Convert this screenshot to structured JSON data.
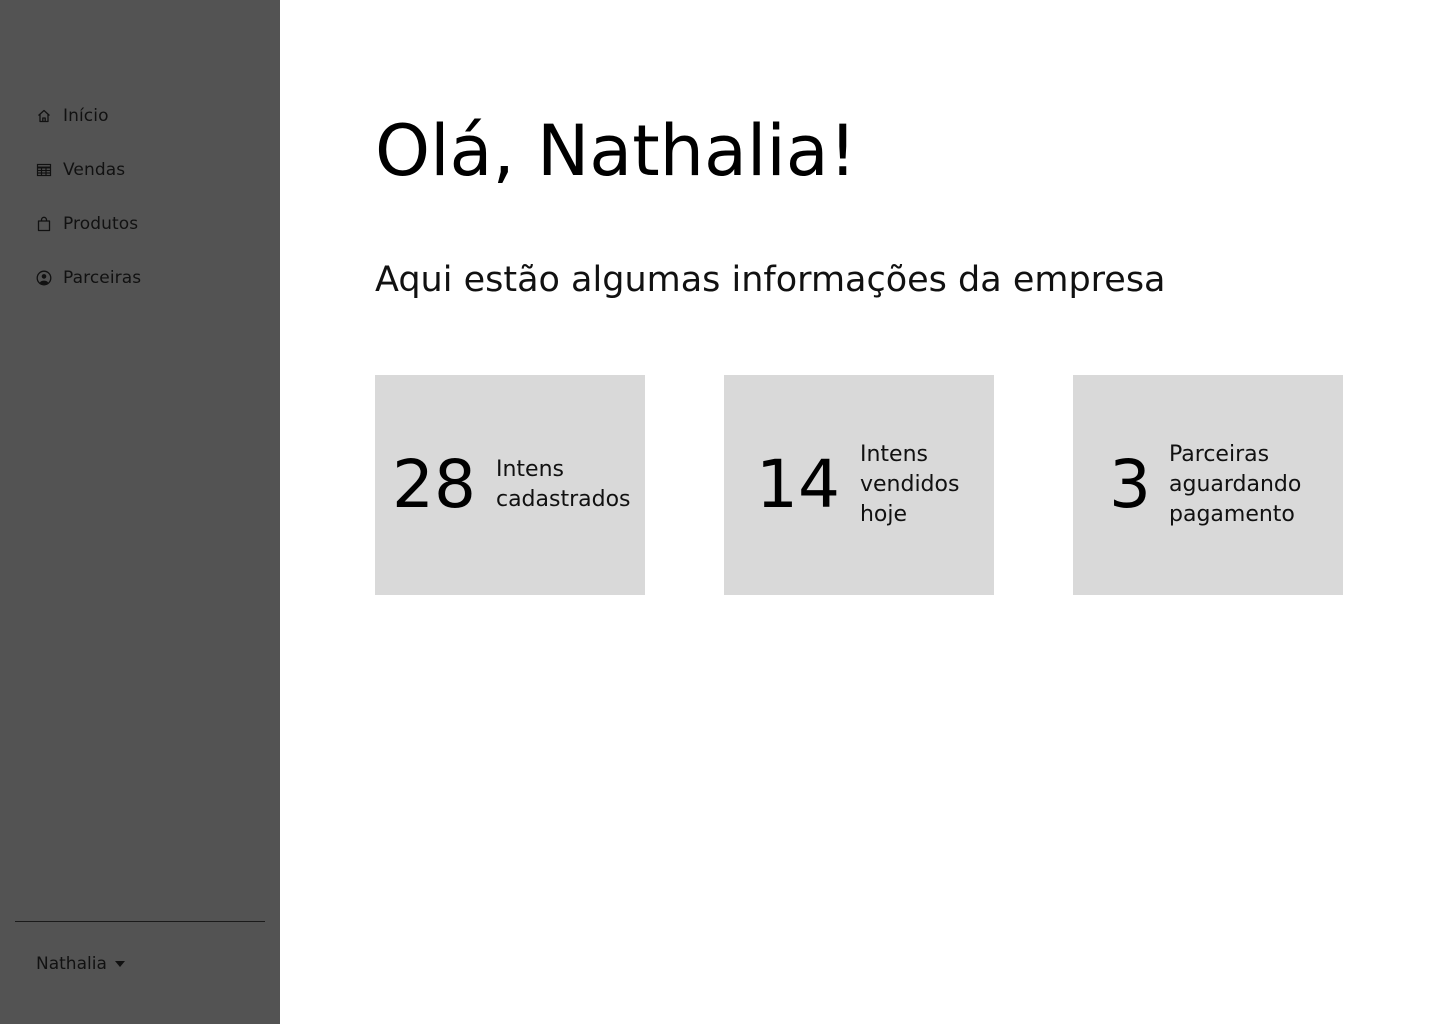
{
  "sidebar": {
    "background": "#535353",
    "items": [
      {
        "label": "Início",
        "icon": "home-icon"
      },
      {
        "label": "Vendas",
        "icon": "table-icon"
      },
      {
        "label": "Produtos",
        "icon": "bag-icon"
      },
      {
        "label": "Parceiras",
        "icon": "user-circle-icon"
      }
    ],
    "user": {
      "name": "Nathalia",
      "icon": "caret-down-icon"
    }
  },
  "main": {
    "greeting": "Olá, Nathalia!",
    "subtitle": "Aqui estão algumas informações da empresa",
    "cards": [
      {
        "value": "28",
        "label": "Intens cadastrados"
      },
      {
        "value": "14",
        "label": "Intens vendidos hoje"
      },
      {
        "value": "3",
        "label": "Parceiras aguardando pagamento"
      }
    ],
    "card_background": "#d9d9d9"
  }
}
